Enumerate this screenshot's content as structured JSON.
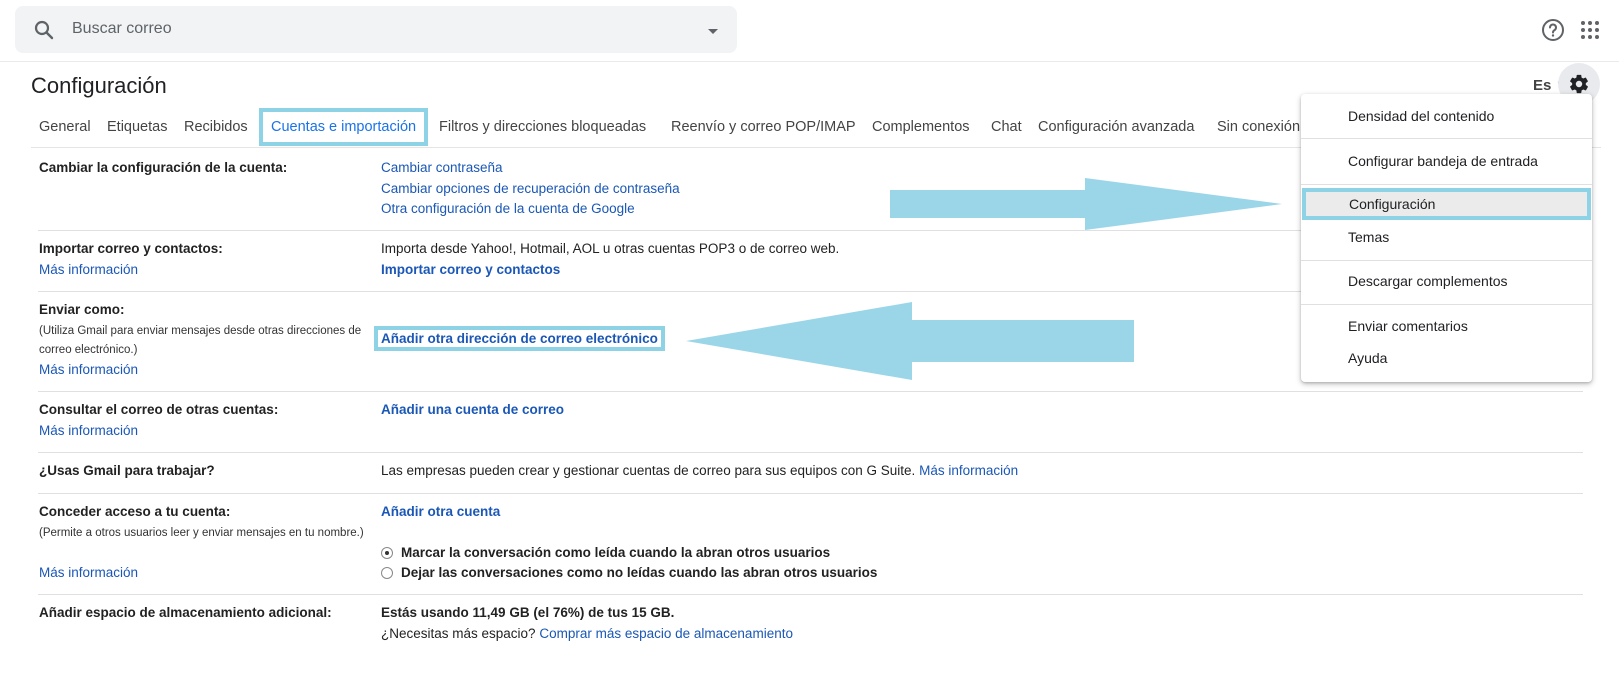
{
  "search": {
    "placeholder": "Buscar correo"
  },
  "header": {
    "title": "Configuración",
    "language": "Es"
  },
  "tabs": [
    {
      "label": "General"
    },
    {
      "label": "Etiquetas"
    },
    {
      "label": "Recibidos"
    },
    {
      "label": "Cuentas e importación",
      "active": true
    },
    {
      "label": "Filtros y direcciones bloqueadas"
    },
    {
      "label": "Reenvío y correo POP/IMAP"
    },
    {
      "label": "Complementos"
    },
    {
      "label": "Chat"
    },
    {
      "label": "Configuración avanzada"
    },
    {
      "label": "Sin conexión"
    }
  ],
  "rows": {
    "cuenta": {
      "label": "Cambiar la configuración de la cuenta:",
      "links": [
        "Cambiar contraseña",
        "Cambiar opciones de recuperación de contraseña",
        "Otra configuración de la cuenta de Google"
      ]
    },
    "importar": {
      "label": "Importar correo y contactos:",
      "more": "Más información",
      "text": "Importa desde Yahoo!, Hotmail, AOL u otras cuentas POP3 o de correo web.",
      "action": "Importar correo y contactos"
    },
    "enviar": {
      "label": "Enviar como:",
      "sub": "(Utiliza Gmail para enviar mensajes desde otras direcciones de correo electrónico.)",
      "more": "Más información",
      "action": "Añadir otra dirección de correo electrónico"
    },
    "consultar": {
      "label": "Consultar el correo de otras cuentas:",
      "more": "Más información",
      "action": "Añadir una cuenta de correo"
    },
    "trabajo": {
      "label": "¿Usas Gmail para trabajar?",
      "text": "Las empresas pueden crear y gestionar cuentas de correo para sus equipos con G Suite.",
      "link": "Más información"
    },
    "acceso": {
      "label": "Conceder acceso a tu cuenta:",
      "sub": "(Permite a otros usuarios leer y enviar mensajes en tu nombre.)",
      "more": "Más información",
      "action": "Añadir otra cuenta",
      "options": [
        "Marcar la conversación como leída cuando la abran otros usuarios",
        "Dejar las conversaciones como no leídas cuando las abran otros usuarios"
      ],
      "selected": 0
    },
    "almacenamiento": {
      "label": "Añadir espacio de almacenamiento adicional:",
      "usage": "Estás usando 11,49 GB (el 76%) de tus 15 GB.",
      "question": "¿Necesitas más espacio?",
      "link": "Comprar más espacio de almacenamiento"
    }
  },
  "menu": {
    "items": [
      "Densidad del contenido",
      "Configurar bandeja de entrada",
      "Configuración",
      "Temas",
      "Descargar complementos",
      "Enviar comentarios",
      "Ayuda"
    ],
    "selected": "Configuración"
  },
  "colors": {
    "link": "#1a57b6",
    "highlight": "#8ed2e6",
    "active_tab": "#1a73e8"
  }
}
